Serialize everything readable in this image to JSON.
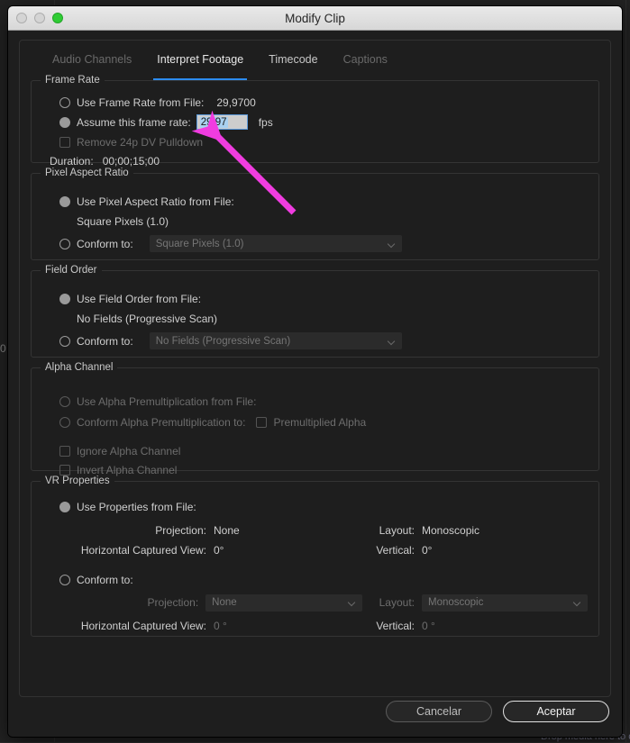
{
  "window": {
    "title": "Modify Clip"
  },
  "traffic_lights": [
    {
      "name": "close",
      "state": "disabled"
    },
    {
      "name": "minimize",
      "state": "disabled"
    },
    {
      "name": "maximize",
      "state": "enabled"
    }
  ],
  "tabs": [
    {
      "label": "Audio Channels",
      "state": "disabled"
    },
    {
      "label": "Interpret Footage",
      "state": "active"
    },
    {
      "label": "Timecode",
      "state": "enabled"
    },
    {
      "label": "Captions",
      "state": "disabled"
    }
  ],
  "frame_rate": {
    "legend": "Frame Rate",
    "use_from_file_label": "Use Frame Rate from File:",
    "use_from_file_value": "29,9700",
    "assume_label": "Assume this frame rate:",
    "assume_value": "29,97",
    "fps_unit": "fps",
    "remove_pulldown_label": "Remove 24p DV Pulldown",
    "duration_label": "Duration:",
    "duration_value": "00;00;15;00"
  },
  "pixel_aspect": {
    "legend": "Pixel Aspect Ratio",
    "use_from_file_label": "Use Pixel Aspect Ratio from File:",
    "file_value": "Square Pixels (1.0)",
    "conform_label": "Conform to:",
    "conform_value": "Square Pixels (1.0)"
  },
  "field_order": {
    "legend": "Field Order",
    "use_from_file_label": "Use Field Order from File:",
    "file_value": "No Fields (Progressive Scan)",
    "conform_label": "Conform to:",
    "conform_value": "No Fields (Progressive Scan)"
  },
  "alpha_channel": {
    "legend": "Alpha Channel",
    "use_premult_label": "Use Alpha Premultiplication from File:",
    "conform_premult_label": "Conform Alpha Premultiplication to:",
    "premultiplied_label": "Premultiplied Alpha",
    "ignore_label": "Ignore Alpha Channel",
    "invert_label": "Invert Alpha Channel"
  },
  "vr_properties": {
    "legend": "VR Properties",
    "use_from_file_label": "Use Properties from File:",
    "file": {
      "projection_label": "Projection:",
      "projection_value": "None",
      "layout_label": "Layout:",
      "layout_value": "Monoscopic",
      "horizontal_label": "Horizontal Captured View:",
      "horizontal_value": "0°",
      "vertical_label": "Vertical:",
      "vertical_value": "0°"
    },
    "conform_label": "Conform to:",
    "conform": {
      "projection_label": "Projection:",
      "projection_value": "None",
      "layout_label": "Layout:",
      "layout_value": "Monoscopic",
      "horizontal_label": "Horizontal Captured View:",
      "horizontal_value": "0 °",
      "vertical_label": "Vertical:",
      "vertical_value": "0 °"
    }
  },
  "footer": {
    "cancel_label": "Cancelar",
    "accept_label": "Aceptar"
  },
  "background": {
    "left_digit": "0",
    "drop_text": "Drop media here to cr"
  },
  "annotation": {
    "arrow_color": "#f03ce0"
  }
}
